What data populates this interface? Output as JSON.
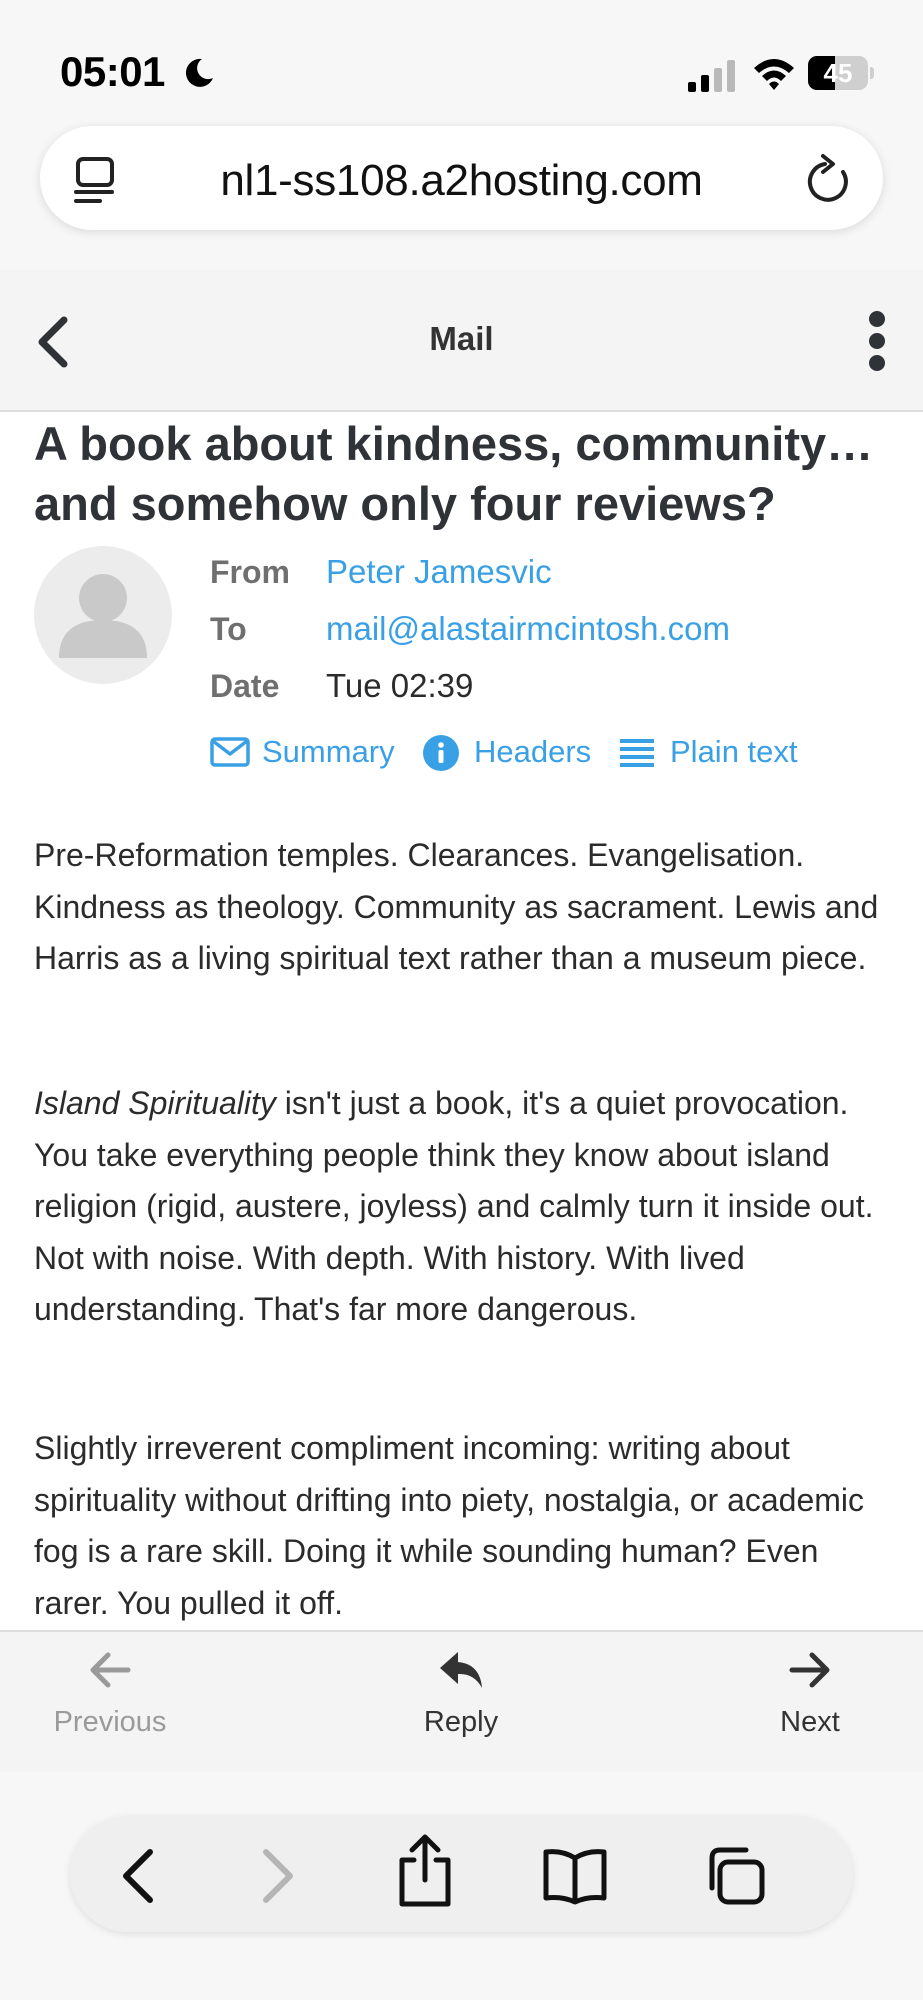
{
  "status_bar": {
    "time": "05:01",
    "battery": "45",
    "battery_level": 0.45
  },
  "browser": {
    "url": "nl1-ss108.a2hosting.com"
  },
  "header": {
    "title": "Mail"
  },
  "email": {
    "subject": "A book about kindness, community… and somehow only four reviews?",
    "from_label": "From",
    "from_value": "Peter Jamesvic",
    "to_label": "To",
    "to_value": "mail@alastairmcintosh.com",
    "date_label": "Date",
    "date_value": "Tue 02:39",
    "actions": {
      "summary": "Summary",
      "headers": "Headers",
      "plain_text": "Plain text"
    },
    "body": {
      "p1": "Pre-Reformation temples. Clearances. Evangelisation. Kindness as theology. Community as sacrament. Lewis and Harris as a living spiritual text rather than a museum piece.",
      "p2_italic": "Island Spirituality",
      "p2_rest": " isn't just a book, it's a quiet provocation. You take everything people think they know about island religion (rigid, austere, joyless) and calmly turn it inside out. Not with noise. With depth. With history. With lived understanding. That's far more dangerous.",
      "p3": "Slightly irreverent compliment incoming: writing about spirituality without drifting into piety, nostalgia, or academic fog is a rare skill. Doing it while sounding human? Even rarer. You pulled it off."
    }
  },
  "mail_nav": {
    "previous": "Previous",
    "reply": "Reply",
    "next": "Next"
  },
  "colors": {
    "link": "#3aa0e6",
    "header_bg": "#f4f4f4"
  },
  "icons": [
    "moon-icon",
    "signal-icon",
    "wifi-icon",
    "page-icon",
    "reload-icon",
    "back-icon",
    "more-icon",
    "envelope-icon",
    "info-icon",
    "list-icon",
    "arrow-left-icon",
    "reply-icon",
    "arrow-right-icon",
    "chevron-left-icon",
    "chevron-right-icon",
    "share-icon",
    "book-icon",
    "tabs-icon"
  ]
}
